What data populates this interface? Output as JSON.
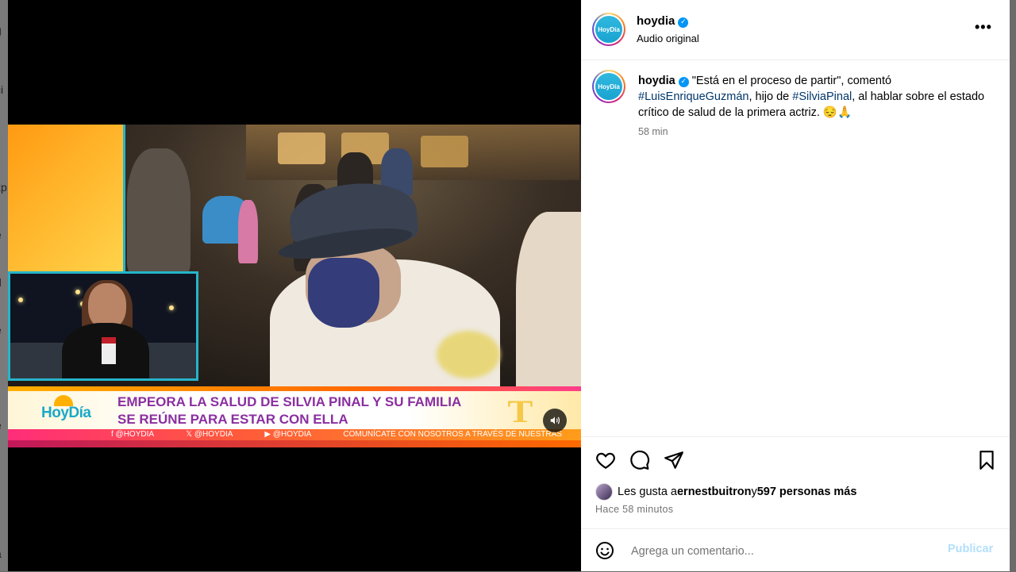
{
  "post": {
    "account": {
      "username": "hoydia",
      "verified": true,
      "audio_label": "Audio original",
      "avatar_text": "HoyDía"
    },
    "caption": {
      "username": "hoydia",
      "text_1": "\"Está en el proceso de partir\", comentó",
      "hashtag_1": "#LuisEnriqueGuzmán",
      "text_2": ", hijo de ",
      "hashtag_2": "#SilviaPinal",
      "text_3": ", al hablar sobre el estado crítico de salud de la primera actriz. 😔🙏",
      "time": "58 min"
    },
    "likes": {
      "prefix": "Les gusta a ",
      "user": "ernestbuitron",
      "middle": " y ",
      "others": "597 personas más"
    },
    "posted_ago": "Hace 58 minutos",
    "comment": {
      "placeholder": "Agrega un comentario...",
      "publish_label": "Publicar"
    },
    "icons": {
      "like": "heart-icon",
      "comment": "comment-icon",
      "share": "send-icon",
      "save": "bookmark-icon",
      "more": "more-options-icon",
      "emoji": "emoji-icon",
      "sound": "speaker-icon"
    }
  },
  "video_overlay": {
    "logo": "HoyDía",
    "headline": "EMPEORA LA SALUD DE SILVIA PINAL Y SU FAMILIA SE REÚNE PARA ESTAR CON ELLA",
    "ticker": [
      "f @HOYDIA",
      "𝕏 @HOYDIA",
      "▶ @HOYDIA",
      "COMUNÍCATE CON NOSOTROS A TRAVÉS DE NUESTRAS"
    ],
    "network_logo": "T"
  },
  "colors": {
    "accent_blue": "#0095f6",
    "hashtag": "#00376b",
    "muted": "#737373",
    "headline_purple": "#8a2fa0"
  }
}
